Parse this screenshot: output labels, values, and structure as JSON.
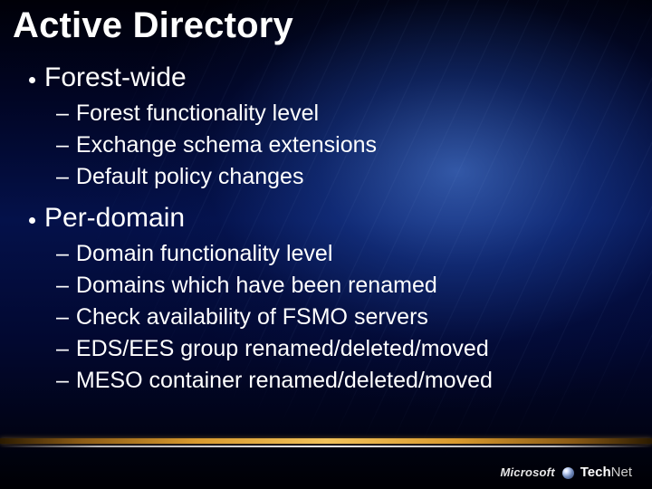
{
  "title": "Active Directory",
  "sections": [
    {
      "label": "Forest-wide",
      "items": [
        "Forest functionality level",
        "Exchange schema extensions",
        "Default policy changes"
      ]
    },
    {
      "label": "Per-domain",
      "items": [
        "Domain functionality level",
        "Domains which have been renamed",
        "Check availability of FSMO servers",
        "EDS/EES group renamed/deleted/moved",
        "MESO container renamed/deleted/moved"
      ]
    }
  ],
  "footer": {
    "brand_left": "Microsoft",
    "brand_right_a": "Tech",
    "brand_right_b": "Net"
  }
}
